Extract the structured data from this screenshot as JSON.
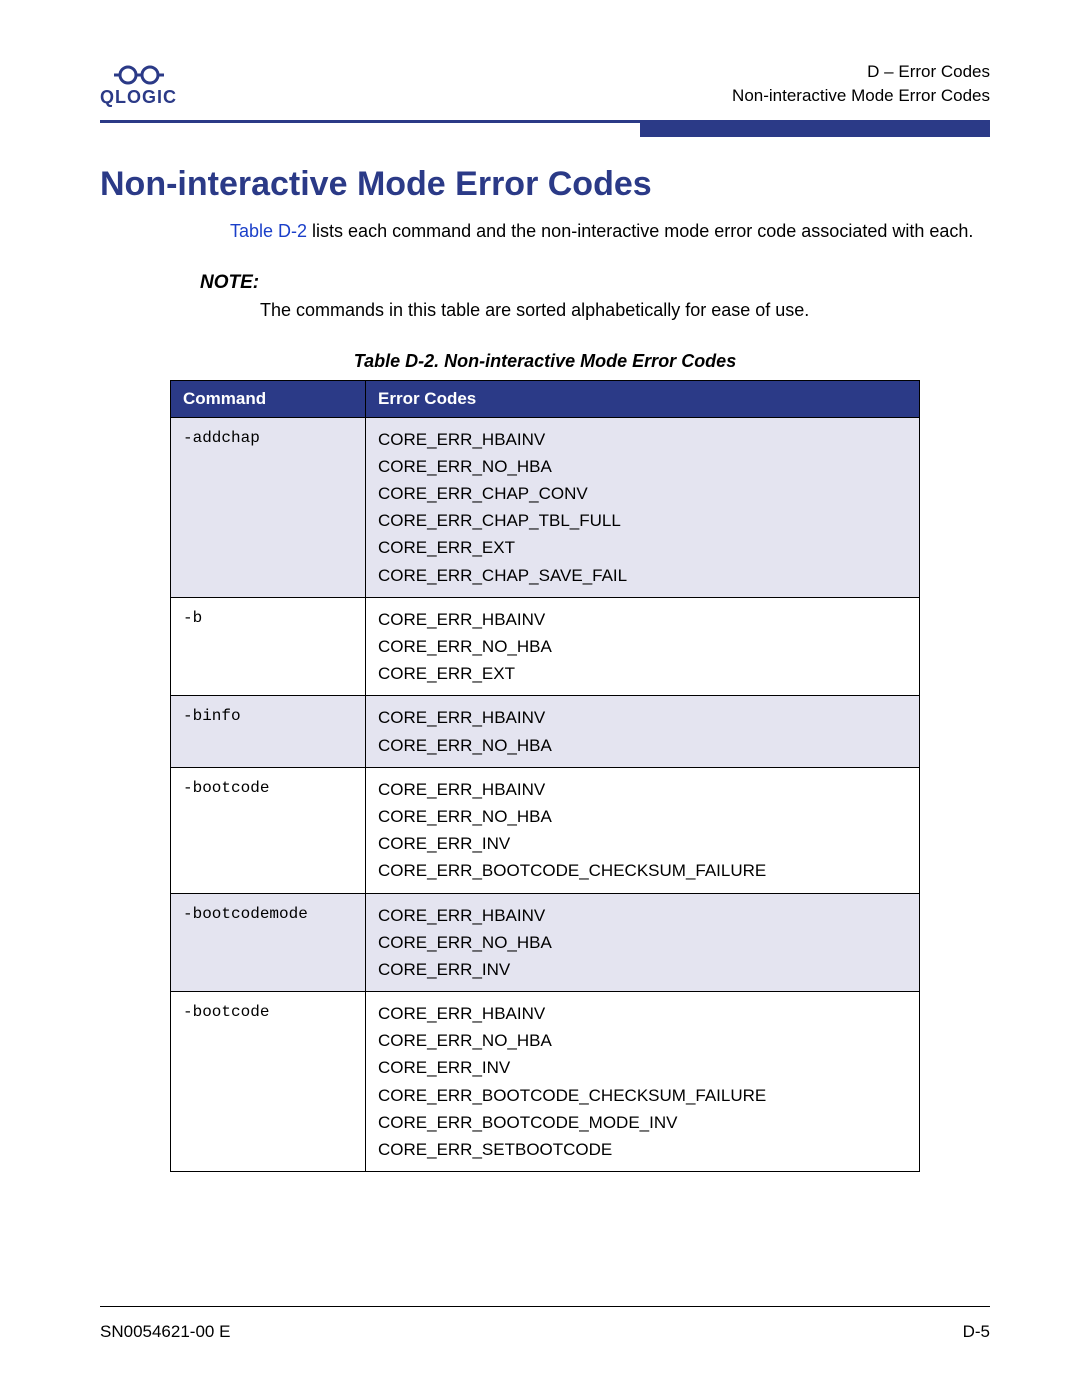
{
  "header": {
    "logo_text": "QLOGIC",
    "right_line1": "D – Error Codes",
    "right_line2": "Non-interactive Mode Error Codes"
  },
  "title": "Non-interactive Mode Error Codes",
  "intro": {
    "ref": "Table D-2",
    "text_after_ref": " lists each command and the non-interactive mode error code associated with each."
  },
  "note": {
    "label": "NOTE:",
    "text": "The commands in this table are sorted alphabetically for ease of use."
  },
  "table": {
    "caption": "Table D-2. Non-interactive Mode Error Codes",
    "col1": "Command",
    "col2": "Error Codes",
    "rows": [
      {
        "cmd": "-addchap",
        "codes": [
          "CORE_ERR_HBAINV",
          "CORE_ERR_NO_HBA",
          "CORE_ERR_CHAP_CONV",
          "CORE_ERR_CHAP_TBL_FULL",
          "CORE_ERR_EXT",
          "CORE_ERR_CHAP_SAVE_FAIL"
        ],
        "alt": true
      },
      {
        "cmd": "-b",
        "codes": [
          "CORE_ERR_HBAINV",
          "CORE_ERR_NO_HBA",
          "CORE_ERR_EXT"
        ],
        "alt": false
      },
      {
        "cmd": "-binfo",
        "codes": [
          "CORE_ERR_HBAINV",
          "CORE_ERR_NO_HBA"
        ],
        "alt": true
      },
      {
        "cmd": "-bootcode",
        "codes": [
          "CORE_ERR_HBAINV",
          "CORE_ERR_NO_HBA",
          "CORE_ERR_INV",
          "CORE_ERR_BOOTCODE_CHECKSUM_FAILURE"
        ],
        "alt": false
      },
      {
        "cmd": "-bootcodemode",
        "codes": [
          "CORE_ERR_HBAINV",
          "CORE_ERR_NO_HBA",
          "CORE_ERR_INV"
        ],
        "alt": true
      },
      {
        "cmd": "-bootcode",
        "codes": [
          "CORE_ERR_HBAINV",
          "CORE_ERR_NO_HBA",
          "CORE_ERR_INV",
          "CORE_ERR_BOOTCODE_CHECKSUM_FAILURE",
          "CORE_ERR_BOOTCODE_MODE_INV",
          "CORE_ERR_SETBOOTCODE"
        ],
        "alt": false
      }
    ]
  },
  "footer": {
    "left": "SN0054621-00 E",
    "right": "D-5"
  }
}
